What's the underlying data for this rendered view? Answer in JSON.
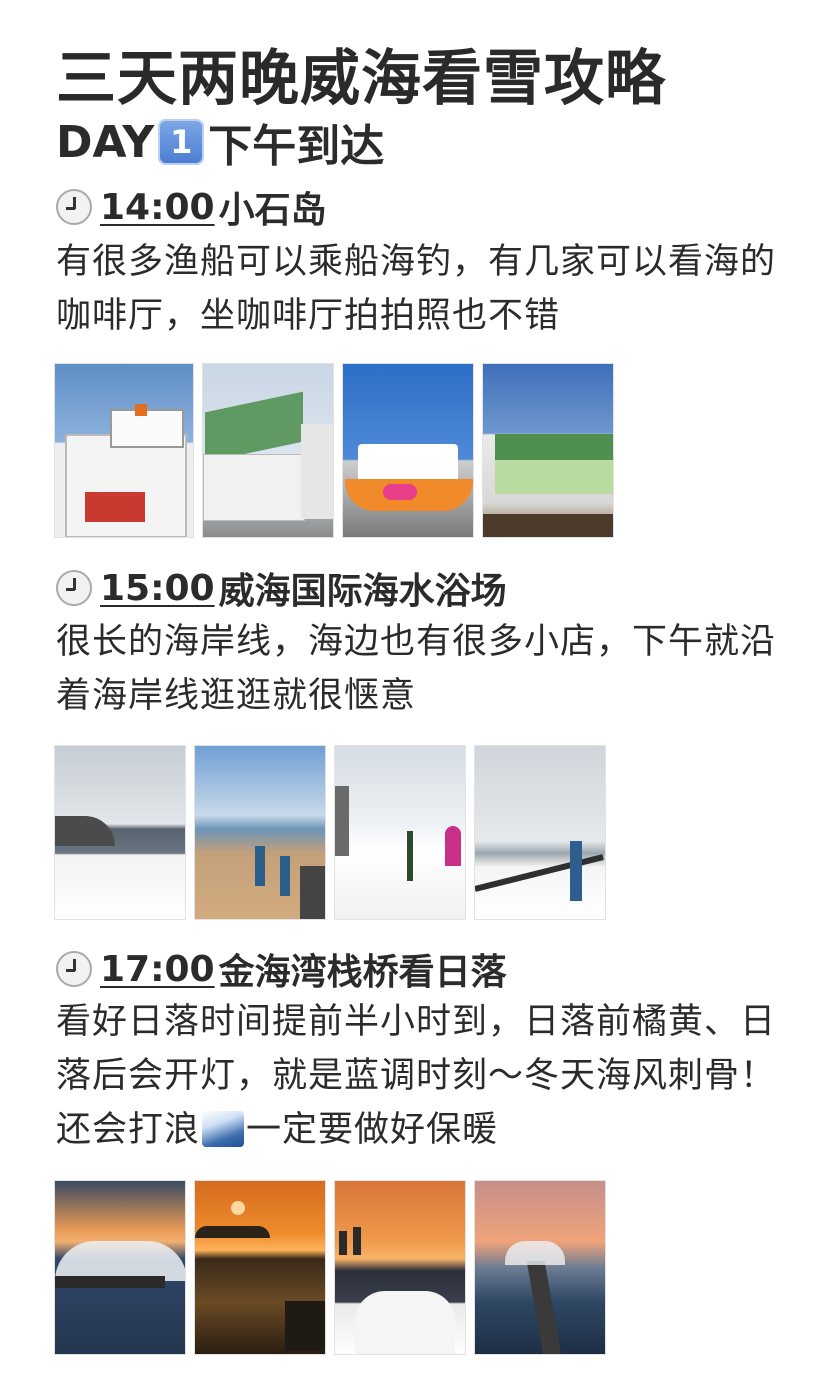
{
  "title": "三天两晚威海看雪攻略",
  "day": {
    "prefix": "DAY",
    "number": "1",
    "text": "下午到达"
  },
  "sections": [
    {
      "time": "14:00",
      "place": "小石岛",
      "desc": "有很多渔船可以乘船海钓，有几家可以看海的咖啡厅，坐咖啡厅拍拍照也不错"
    },
    {
      "time": "15:00",
      "place": "威海国际海水浴场",
      "desc": "很长的海岸线，海边也有很多小店，下午就沿着海岸线逛逛就很惬意"
    },
    {
      "time": "17:00",
      "place": "金海湾栈桥看日落",
      "desc_before": "看好日落时间提前半小时到，日落前橘黄、日落后会开灯，就是蓝调时刻～冬天海风刺骨！还会打浪",
      "desc_after": "一定要做好保暖"
    }
  ],
  "icons": {
    "clock": "clock-icon",
    "keycap": "keycap-one-icon",
    "wave": "water-wave-icon"
  },
  "colors": {
    "text": "#2b2b2b",
    "background": "#ffffff",
    "keycap": "#5b8bd8"
  }
}
